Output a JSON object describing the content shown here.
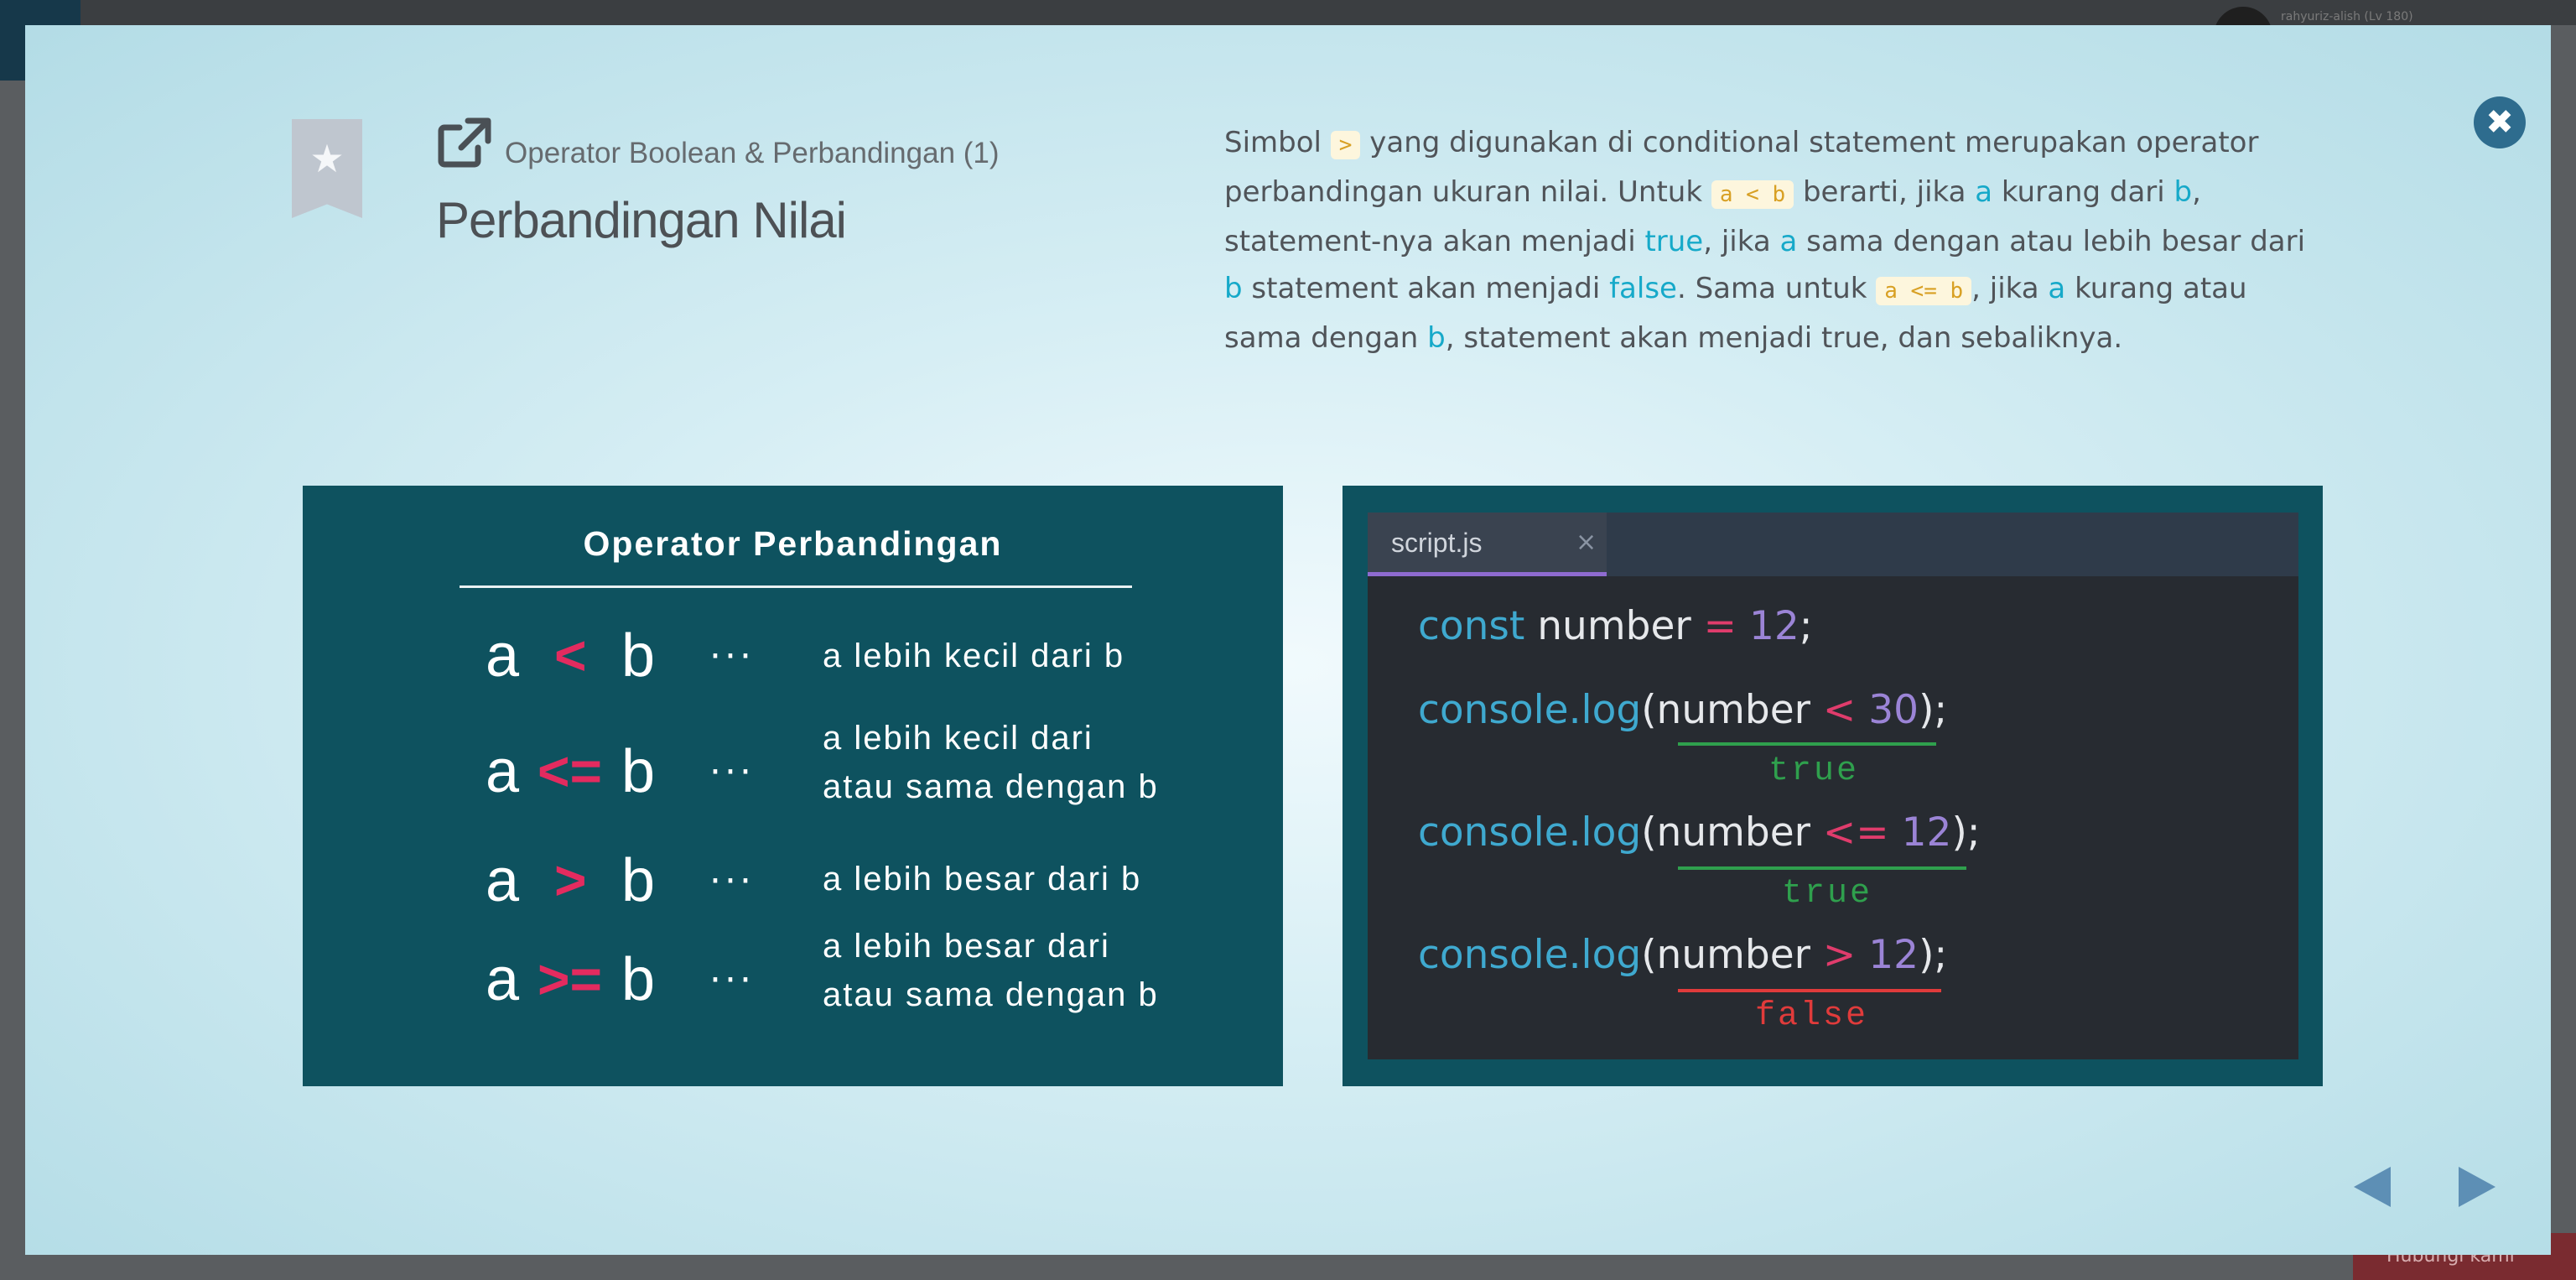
{
  "background": {
    "username": "rahyuriz-alish (Lv 180)",
    "cta_label": "Hubungi kami"
  },
  "header": {
    "breadcrumb": "Operator Boolean & Perbandingan (1)",
    "title": "Perbandingan Nilai",
    "close_icon": "close-icon",
    "bookmark_icon": "star-bookmark-icon",
    "link_icon": "external-link-icon"
  },
  "description": {
    "p1": "Simbol ",
    "chip1": ">",
    "p2": " yang digunakan di conditional statement merupakan operator perbandingan ukuran nilai. Untuk ",
    "chip2": "a < b",
    "p3": " berarti, jika ",
    "a1": "a",
    "p4": " kurang dari ",
    "b1": "b",
    "p5": ", statement-nya akan menjadi ",
    "true1": "true",
    "p6": ", jika ",
    "a2": "a",
    "p7": " sama dengan atau lebih besar dari ",
    "b2": "b",
    "p8": " statement akan menjadi ",
    "false1": "false",
    "p9": ". Sama untuk ",
    "chip3": "a <= b",
    "p10": ", jika ",
    "a3": "a",
    "p11": " kurang atau sama dengan ",
    "b3": "b",
    "p12": ", statement akan menjadi true, dan sebaliknya."
  },
  "operators_panel": {
    "title": "Operator Perbandingan",
    "rows": [
      {
        "a": "a",
        "sym": "<",
        "b": "b",
        "dots": "···",
        "desc1": "a lebih kecil dari b",
        "desc2": ""
      },
      {
        "a": "a",
        "sym": "<=",
        "b": "b",
        "dots": "···",
        "desc1": "a lebih kecil dari",
        "desc2": "atau sama dengan b"
      },
      {
        "a": "a",
        "sym": ">",
        "b": "b",
        "dots": "···",
        "desc1": "a lebih besar dari b",
        "desc2": ""
      },
      {
        "a": "a",
        "sym": ">=",
        "b": "b",
        "dots": "···",
        "desc1": "a lebih besar dari",
        "desc2": "atau sama dengan b"
      }
    ]
  },
  "code_panel": {
    "tab": "script.js",
    "tab_close": "×",
    "line1": {
      "kw": "const",
      "ident": " number ",
      "op": "=",
      "num": " 12",
      "end": ";"
    },
    "line2": {
      "obj": "console.log",
      "open": "(",
      "ident": "number ",
      "op": "<",
      "num": " 30",
      "close": ");"
    },
    "result2": "true",
    "line3": {
      "obj": "console.log",
      "open": "(",
      "ident": "number ",
      "op": "<=",
      "num": " 12",
      "close": ");"
    },
    "result3": "true",
    "line4": {
      "obj": "console.log",
      "open": "(",
      "ident": "number ",
      "op": ">",
      "num": " 12",
      "close": ");"
    },
    "result4": "false"
  },
  "colors": {
    "true": "#2fa04d",
    "false": "#e03b3b",
    "accent": "#16a9c9",
    "panel": "#0e525f"
  }
}
